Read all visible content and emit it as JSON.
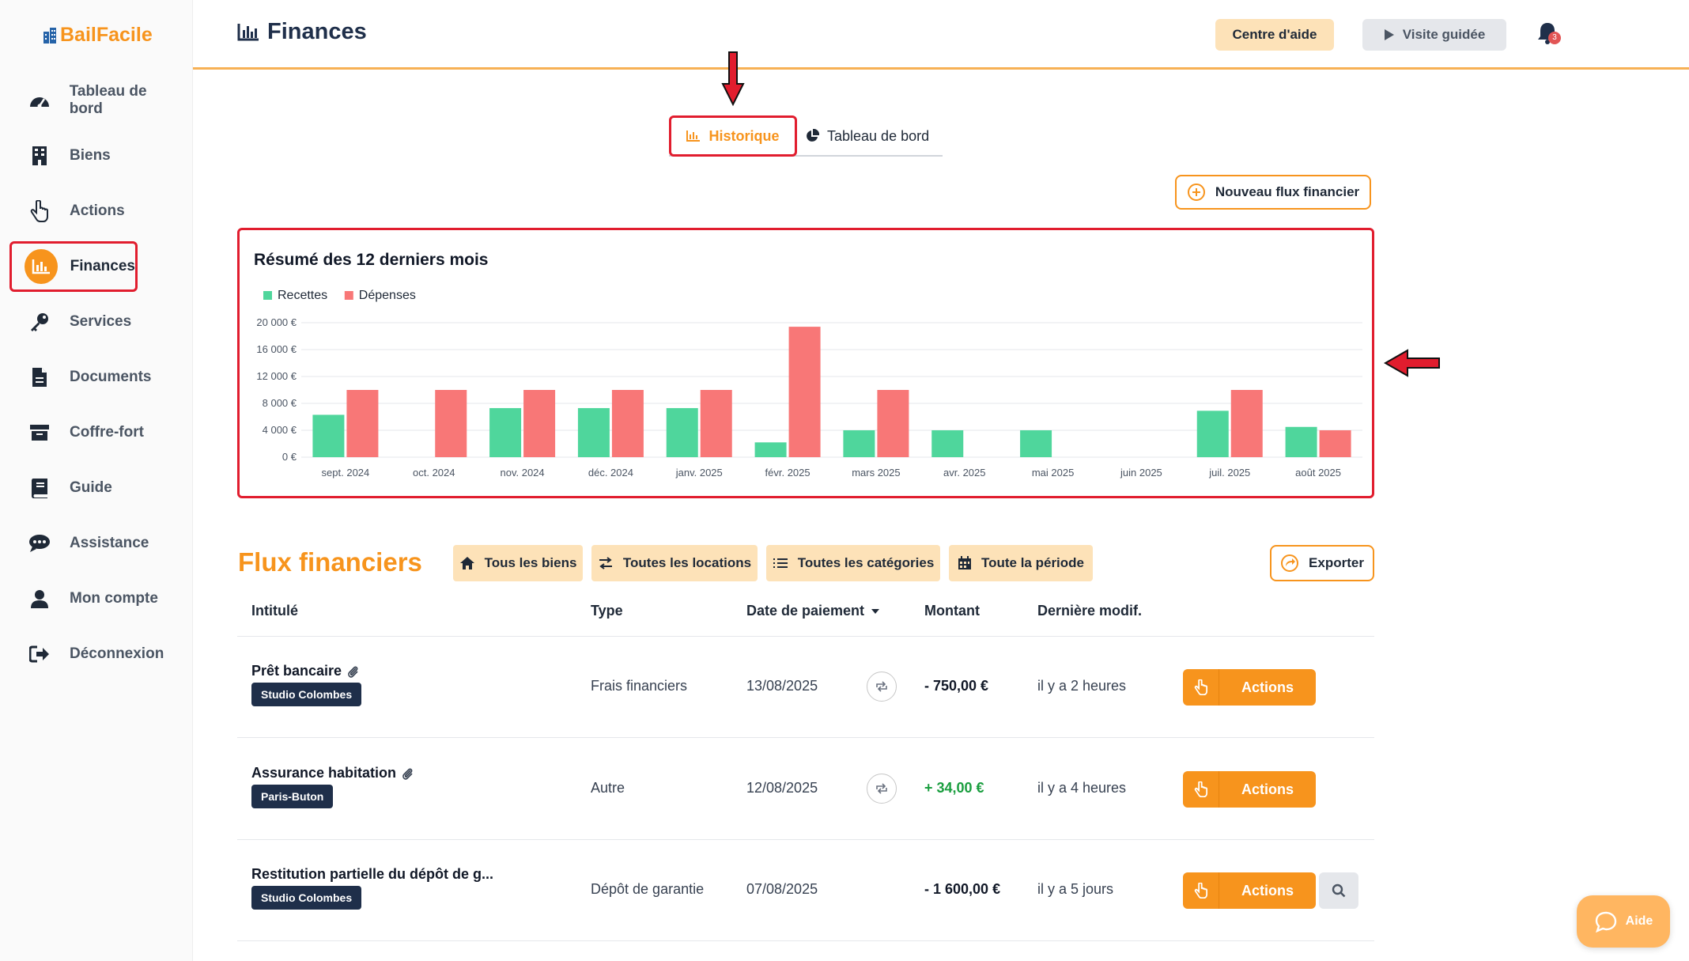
{
  "app": {
    "name": "BailFacile"
  },
  "sidebar": {
    "items": [
      {
        "label": "Tableau de bord",
        "icon": "gauge-icon"
      },
      {
        "label": "Biens",
        "icon": "building-icon"
      },
      {
        "label": "Actions",
        "icon": "hand-pointer-icon"
      },
      {
        "label": "Finances",
        "icon": "chart-bar-icon",
        "active": true
      },
      {
        "label": "Services",
        "icon": "key-icon"
      },
      {
        "label": "Documents",
        "icon": "file-icon"
      },
      {
        "label": "Coffre-fort",
        "icon": "archive-box-icon"
      },
      {
        "label": "Guide",
        "icon": "book-icon"
      },
      {
        "label": "Assistance",
        "icon": "chat-bubble-icon"
      },
      {
        "label": "Mon compte",
        "icon": "user-icon"
      },
      {
        "label": "Déconnexion",
        "icon": "sign-out-icon"
      }
    ]
  },
  "header": {
    "title": "Finances",
    "help_label": "Centre d'aide",
    "tour_label": "Visite guidée",
    "notification_count": "3"
  },
  "tabs": {
    "historique": "Historique",
    "tableau": "Tableau de bord"
  },
  "new_flow_label": "Nouveau flux financier",
  "chart_data": {
    "type": "bar",
    "title": "Résumé des 12 derniers mois",
    "categories": [
      "sept. 2024",
      "oct. 2024",
      "nov. 2024",
      "déc. 2024",
      "janv. 2025",
      "févr. 2025",
      "mars 2025",
      "avr. 2025",
      "mai 2025",
      "juin 2025",
      "juil. 2025",
      "août 2025"
    ],
    "series": [
      {
        "name": "Recettes",
        "color": "#4fd69c",
        "values": [
          6300,
          0,
          7300,
          7300,
          7300,
          2200,
          4000,
          4000,
          4000,
          0,
          6900,
          4500
        ]
      },
      {
        "name": "Dépenses",
        "color": "#f87777",
        "values": [
          10000,
          10000,
          10000,
          10000,
          10000,
          19400,
          10000,
          0,
          0,
          0,
          10000,
          4000
        ]
      }
    ],
    "yticks": [
      "0 €",
      "4 000 €",
      "8 000 €",
      "12 000 €",
      "16 000 €",
      "20 000 €"
    ],
    "ylim": [
      0,
      20000
    ],
    "grid": true,
    "legend": "top-left"
  },
  "flux": {
    "title": "Flux financiers",
    "filters": {
      "biens": "Tous les biens",
      "locations": "Toutes les locations",
      "categories": "Toutes les catégories",
      "periode": "Toute la période"
    },
    "export_label": "Exporter",
    "columns": {
      "intitule": "Intitulé",
      "type": "Type",
      "date": "Date de paiement",
      "montant": "Montant",
      "modif": "Dernière modif."
    },
    "rows": [
      {
        "title": "Prêt bancaire",
        "property": "Studio Colombes",
        "type": "Frais financiers",
        "date": "13/08/2025",
        "amount": "- 750,00 €",
        "modified": "il y a 2 heures",
        "actions": "Actions"
      },
      {
        "title": "Assurance habitation",
        "property": "Paris-Buton",
        "type": "Autre",
        "date": "12/08/2025",
        "amount": "+ 34,00 €",
        "modified": "il y a 4 heures",
        "actions": "Actions"
      },
      {
        "title": "Restitution partielle du dépôt de g...",
        "property": "Studio Colombes",
        "type": "Dépôt de garantie",
        "date": "07/08/2025",
        "amount": "- 1 600,00 €",
        "modified": "il y a 5 jours",
        "actions": "Actions"
      }
    ]
  },
  "aide_label": "Aide"
}
